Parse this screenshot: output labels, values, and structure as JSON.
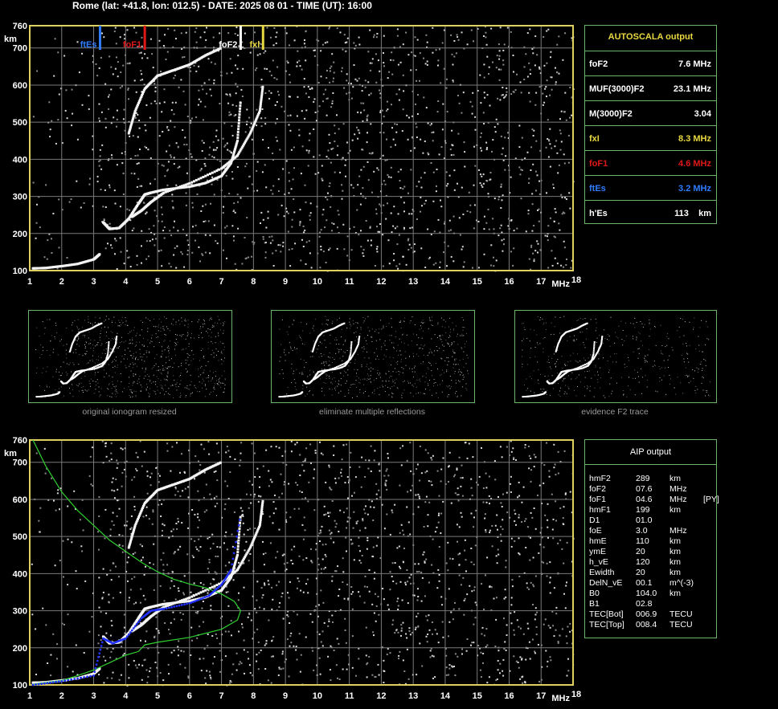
{
  "header": "Rome (lat: +41.8, lon: 012.5) - DATE: 2025 08 01 - TIME (UT): 16:00",
  "colors": {
    "axis": "#e0d060",
    "grid": "#7a7a7a",
    "table_border": "#6db56d",
    "ftEs": "#2f7cff",
    "foF1": "#e01818",
    "foF2": "#ffffff",
    "fxI": "#e8d840",
    "model": "#30d030",
    "profile": "#2030ff"
  },
  "chart_data": [
    {
      "type": "scatter",
      "name": "ionogram",
      "xlabel": "MHz",
      "ylabel": "km",
      "xlim": [
        1,
        18
      ],
      "ylim": [
        100,
        760
      ],
      "x_ticks": [
        1,
        2,
        3,
        4,
        5,
        6,
        7,
        8,
        9,
        10,
        11,
        12,
        13,
        14,
        15,
        16,
        17,
        18
      ],
      "y_ticks": [
        100,
        200,
        300,
        400,
        500,
        600,
        700,
        760
      ],
      "markers": [
        {
          "label": "ftEs",
          "x": 3.2,
          "color": "#2f7cff"
        },
        {
          "label": "foF1",
          "x": 4.6,
          "color": "#e01818"
        },
        {
          "label": "foF2",
          "x": 7.6,
          "color": "#ffffff"
        },
        {
          "label": "fxl",
          "x": 8.3,
          "color": "#e8d840"
        }
      ],
      "traces": [
        {
          "points": [
            [
              1.1,
              106
            ],
            [
              1.5,
              107
            ],
            [
              2,
              112
            ],
            [
              2.5,
              118
            ],
            [
              3.0,
              130
            ],
            [
              3.2,
              145
            ]
          ]
        },
        {
          "points": [
            [
              3.3,
              230
            ],
            [
              3.5,
              212
            ],
            [
              3.8,
              215
            ],
            [
              4.1,
              240
            ],
            [
              4.4,
              280
            ],
            [
              4.6,
              305
            ],
            [
              4.8,
              310
            ],
            [
              5.2,
              318
            ],
            [
              6,
              326
            ],
            [
              6.5,
              336
            ],
            [
              7,
              355
            ],
            [
              7.3,
              390
            ],
            [
              7.5,
              450
            ],
            [
              7.6,
              560
            ]
          ]
        },
        {
          "points": [
            [
              4.2,
              245
            ],
            [
              4.5,
              262
            ],
            [
              4.8,
              285
            ],
            [
              5.2,
              310
            ],
            [
              6,
              335
            ],
            [
              7,
              375
            ],
            [
              7.5,
              410
            ],
            [
              7.9,
              470
            ],
            [
              8.2,
              530
            ],
            [
              8.3,
              600
            ]
          ]
        },
        {
          "points": [
            [
              4.1,
              470
            ],
            [
              4.3,
              530
            ],
            [
              4.6,
              590
            ],
            [
              5.0,
              625
            ],
            [
              5.5,
              640
            ],
            [
              6.0,
              655
            ],
            [
              6.5,
              680
            ],
            [
              7.0,
              700
            ]
          ]
        }
      ]
    },
    {
      "type": "scatter",
      "name": "aip",
      "xlabel": "MHz",
      "ylabel": "km",
      "xlim": [
        1,
        18
      ],
      "ylim": [
        100,
        760
      ],
      "x_ticks": [
        1,
        2,
        3,
        4,
        5,
        6,
        7,
        8,
        9,
        10,
        11,
        12,
        13,
        14,
        15,
        16,
        17,
        18
      ],
      "y_ticks": [
        100,
        200,
        300,
        400,
        500,
        600,
        700,
        760
      ],
      "model_curve": [
        [
          1.1,
          760
        ],
        [
          1.5,
          690
        ],
        [
          2,
          620
        ],
        [
          2.5,
          570
        ],
        [
          3,
          530
        ],
        [
          3.5,
          490
        ],
        [
          4,
          460
        ],
        [
          4.5,
          430
        ],
        [
          5,
          405
        ],
        [
          5.5,
          385
        ],
        [
          6,
          372
        ],
        [
          6.5,
          362
        ],
        [
          7,
          345
        ],
        [
          7.4,
          325
        ],
        [
          7.6,
          300
        ],
        [
          7.5,
          275
        ],
        [
          7,
          250
        ],
        [
          6,
          228
        ],
        [
          5,
          215
        ],
        [
          4.6,
          208
        ],
        [
          4.4,
          190
        ],
        [
          4.0,
          180
        ],
        [
          3.5,
          160
        ],
        [
          3.0,
          140
        ],
        [
          2.5,
          125
        ],
        [
          2,
          112
        ],
        [
          1.1,
          102
        ]
      ],
      "profile": [
        [
          1.1,
          100
        ],
        [
          2,
          110
        ],
        [
          3,
          125
        ],
        [
          3.3,
          225
        ],
        [
          3.6,
          212
        ],
        [
          4,
          225
        ],
        [
          4.5,
          280
        ],
        [
          4.8,
          300
        ],
        [
          5.2,
          305
        ],
        [
          6,
          320
        ],
        [
          6.6,
          340
        ],
        [
          7,
          370
        ],
        [
          7.3,
          410
        ],
        [
          7.6,
          560
        ]
      ]
    }
  ],
  "autoscala": {
    "title": "AUTOSCALA output",
    "rows": [
      {
        "label": "foF2",
        "value": "7.6 MHz",
        "color": "#ffffff"
      },
      {
        "label": "MUF(3000)F2",
        "value": "23.1 MHz",
        "color": "#ffffff"
      },
      {
        "label": "M(3000)F2",
        "value": "3.04",
        "color": "#ffffff"
      },
      {
        "label": "fxI",
        "value": "8.3 MHz",
        "color": "#e8d840"
      },
      {
        "label": "foF1",
        "value": "4.6 MHz",
        "color": "#e01818"
      },
      {
        "label": "ftEs",
        "value": "3.2 MHz",
        "color": "#2f7cff"
      },
      {
        "label": "h'Es",
        "value": "113    km",
        "color": "#ffffff"
      }
    ]
  },
  "thumbnails": [
    {
      "caption": "original ionogram resized"
    },
    {
      "caption": "eliminate multiple reflections"
    },
    {
      "caption": "evidence F2 trace"
    }
  ],
  "aip": {
    "title": "AIP output",
    "rows": [
      {
        "k": "hmF2",
        "v": "289",
        "u": "km",
        "x": ""
      },
      {
        "k": "foF2",
        "v": "07.6",
        "u": "MHz",
        "x": ""
      },
      {
        "k": "foF1",
        "v": "04.6",
        "u": "MHz",
        "x": "[PY]"
      },
      {
        "k": "hmF1",
        "v": "199",
        "u": "km",
        "x": ""
      },
      {
        "k": "D1",
        "v": "01.0",
        "u": "",
        "x": ""
      },
      {
        "k": "foE",
        "v": "3.0",
        "u": "MHz",
        "x": ""
      },
      {
        "k": "hmE",
        "v": "110",
        "u": "km",
        "x": ""
      },
      {
        "k": "ymE",
        "v": "20",
        "u": "km",
        "x": ""
      },
      {
        "k": "h_vE",
        "v": "120",
        "u": "km",
        "x": ""
      },
      {
        "k": "Ewidth",
        "v": "20",
        "u": "km",
        "x": ""
      },
      {
        "k": "DelN_vE",
        "v": "00.1",
        "u": "m^(-3)",
        "x": ""
      },
      {
        "k": "B0",
        "v": "104.0",
        "u": "km",
        "x": ""
      },
      {
        "k": "B1",
        "v": "02.8",
        "u": "",
        "x": ""
      },
      {
        "k": "TEC[Bot]",
        "v": "006.9",
        "u": "TECU",
        "x": ""
      },
      {
        "k": "TEC[Top]",
        "v": "008.4",
        "u": "TECU",
        "x": ""
      }
    ]
  }
}
